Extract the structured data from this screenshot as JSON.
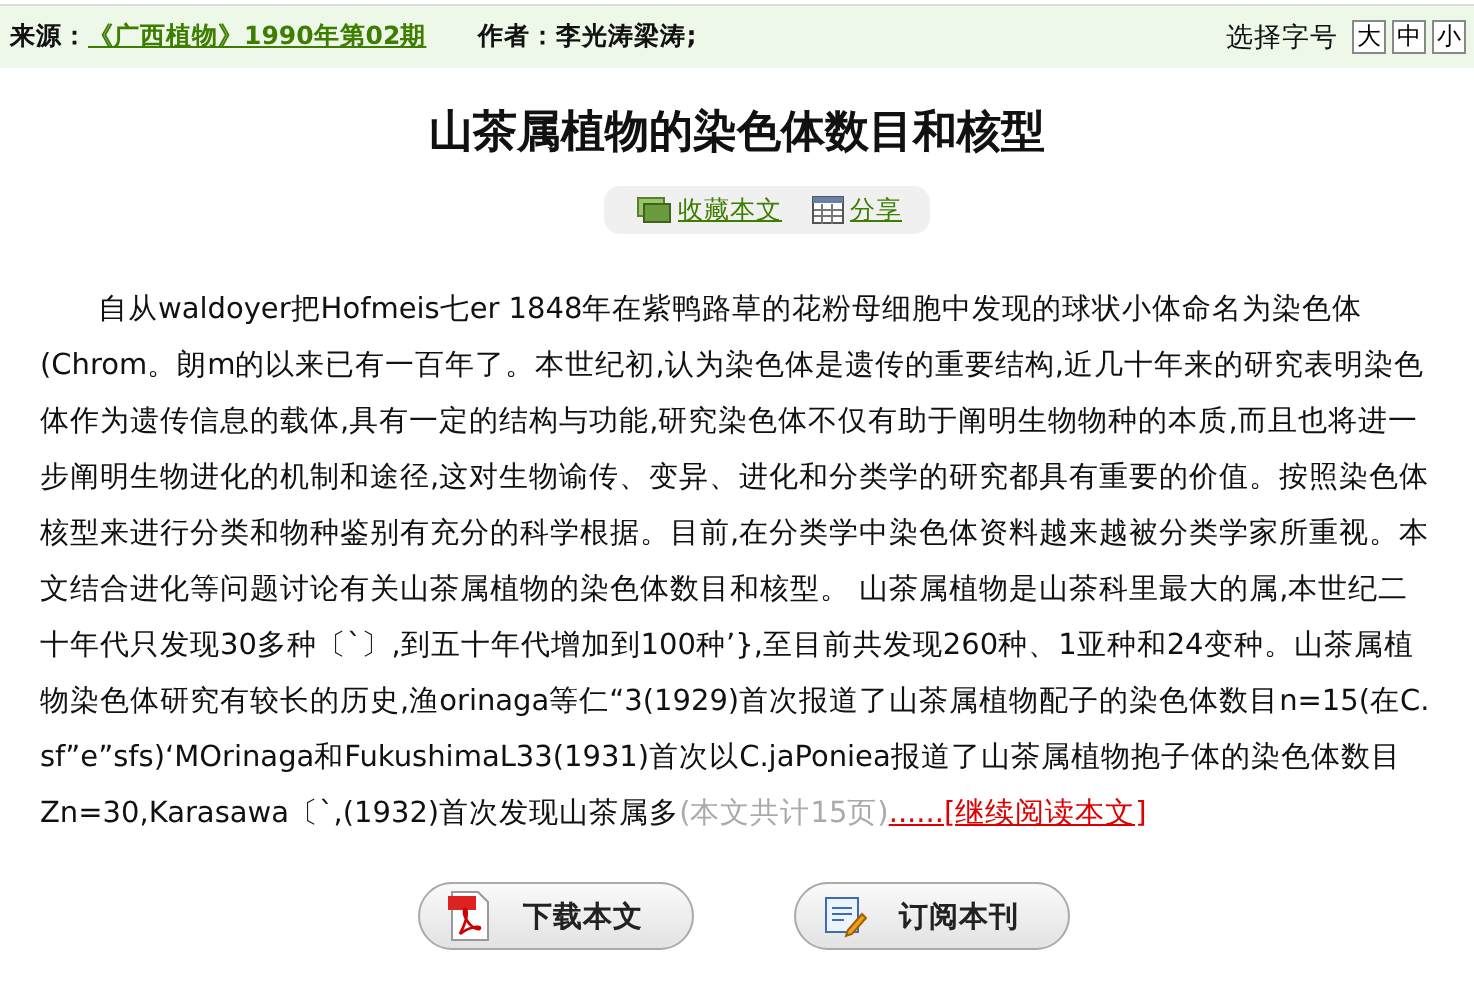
{
  "source": {
    "label": "来源：",
    "journal": "《广西植物》1990年第02期"
  },
  "author": {
    "label": "作者：",
    "names": "李光涛梁涛;"
  },
  "font_size": {
    "label": "选择字号",
    "options": [
      {
        "label": "大"
      },
      {
        "label": "中"
      },
      {
        "label": "小"
      }
    ]
  },
  "title": "山茶属植物的染色体数目和核型",
  "actions": [
    {
      "label": "收藏本文",
      "kind": "favorite"
    },
    {
      "label": "分享",
      "kind": "share"
    }
  ],
  "body": {
    "text": "自从waldoyer把Hofmeis七er 1848年在紫鸭路草的花粉母细胞中发现的球状小体命名为染色体(Chrom。朗m的以来已有一百年了。本世纪初,认为染色体是遗传的重要结构,近几十年来的研究表明染色体作为遗传信息的载体,具有一定的结构与功能,研究染色体不仅有助于阐明生物物种的本质,而且也将进一步阐明生物进化的机制和途径,这对生物谕传、变异、进化和分类学的研究都具有重要的价值。按照染色体核型来进行分类和物种鉴别有充分的科学根据。目前,在分类学中染色体资料越来越被分类学家所重视。本文结合进化等问题讨论有关山茶属植物的染色体数目和核型。 山茶属植物是山茶科里最大的属,本世纪二十年代只发现30多种〔`〕,到五十年代增加到100种’},至目前共发现260种、1亚种和24变种。山茶属植物染色体研究有较长的历史,渔orinaga等仁“3(1929)首次报道了山茶属植物配子的染色体数目n=15(在C. sf”e”sfs)‘MOrinaga和FukushimaL33(1931)首次以C.jaPoniea报道了山茶属植物抱子体的染色体数目Zn=30,Karasawa〔`,(1932)首次发现山茶属多",
    "page_count": "(本文共计15页)",
    "read_more": "......[继续阅读本文]"
  },
  "buttons": [
    {
      "label": "下载本文",
      "kind": "download"
    },
    {
      "label": "订阅本刊",
      "kind": "subscribe"
    }
  ]
}
